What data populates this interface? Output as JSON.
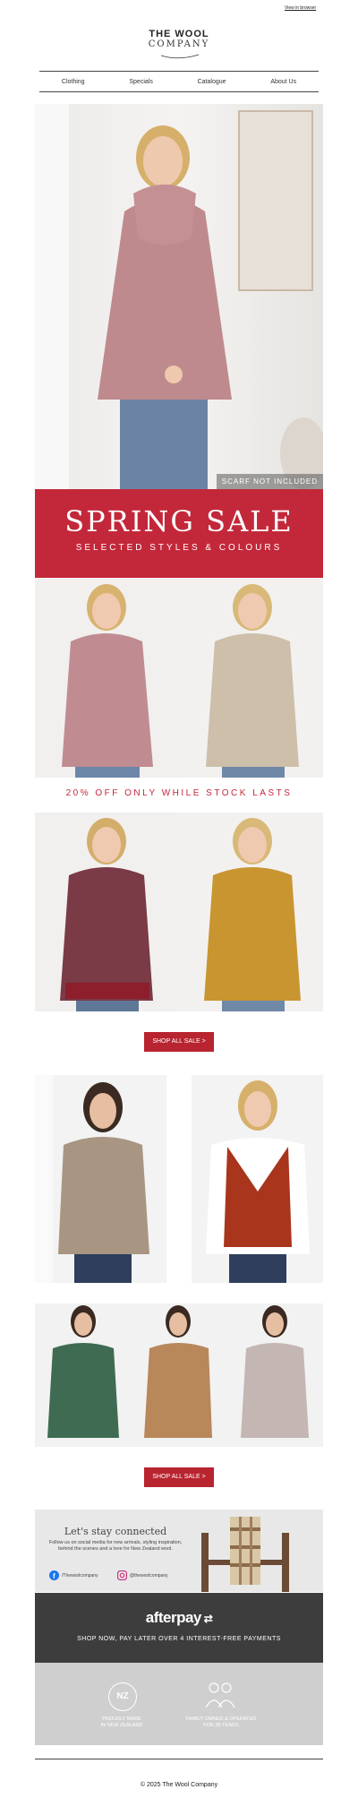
{
  "header": {
    "view_in_browser": "View in browser",
    "logo_line1": "THE WOOL",
    "logo_line2": "COMPANY"
  },
  "nav": {
    "items": [
      {
        "label": "Clothing"
      },
      {
        "label": "Specials"
      },
      {
        "label": "Catalogue"
      },
      {
        "label": "About Us"
      }
    ]
  },
  "hero": {
    "caption": "SCARF NOT INCLUDED"
  },
  "banner": {
    "title": "SPRING SALE",
    "subtitle": "SELECTED STYLES & COLOURS"
  },
  "promo": {
    "text": "20% OFF ONLY WHILE STOCK LASTS"
  },
  "buttons": {
    "shop_sale_1": "SHOP ALL SALE >",
    "shop_sale_2": "SHOP ALL SALE >"
  },
  "social": {
    "heading": "Let's stay connected",
    "body": "Follow us on social media for new arrivals, styling inspiration, behind the scenes and a love for New Zealand wool.",
    "facebook": "/Thewoolcompany",
    "instagram": "@thewoolcompany"
  },
  "afterpay": {
    "logo": "afterpay",
    "text": "SHOP NOW, PAY LATER OVER 4 INTEREST-FREE PAYMENTS"
  },
  "badges": {
    "nz_mark": "NZ",
    "nz_text_1": "PROUDLY MADE",
    "nz_text_2": "IN NEW ZEALAND",
    "family_text_1": "FAMILY OWNED & OPERATED",
    "family_text_2": "FOR 35 YEARS"
  },
  "footer": {
    "copyright": "© 2025 The Wool Company"
  },
  "colors": {
    "brand_red": "#c3283a",
    "button_red": "#b8242f",
    "afterpay_bg": "#3d3d3d"
  }
}
